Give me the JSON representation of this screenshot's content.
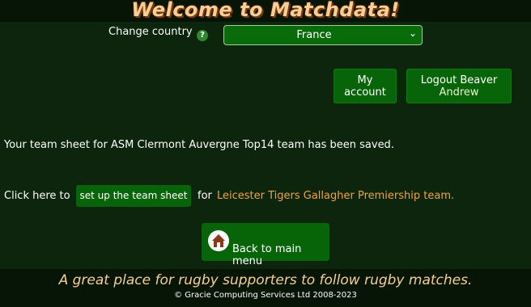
{
  "header": {
    "title": "Welcome to Matchdata!"
  },
  "country": {
    "label": "Change country",
    "help_glyph": "?",
    "selected": "France",
    "chevron_glyph": "⌄"
  },
  "account": {
    "my_account_line1": "My",
    "my_account_line2": "account",
    "logout_line1": "Logout Beaver",
    "logout_line2": "Andrew"
  },
  "messages": {
    "saved": "Your team sheet for ASM Clermont Auvergne Top14 team has been saved.",
    "click_here": "Click here to",
    "setup_button": "set up the team sheet",
    "for": "for",
    "team_link": "Leicester Tigers Gallagher Premiership team."
  },
  "nav": {
    "back_label": "Back to main menu"
  },
  "footer": {
    "tagline": "A great place for rugby supporters to follow rugby matches.",
    "copyright": "© Gracie Computing Services Ltd 2008-2023"
  },
  "colors": {
    "background": "#0d240d",
    "button": "#086408",
    "title": "#f6cf95",
    "link": "#f0a44a"
  },
  "icons": {
    "help": "help-icon",
    "home": "home-icon",
    "chevron": "chevron-down-icon"
  }
}
